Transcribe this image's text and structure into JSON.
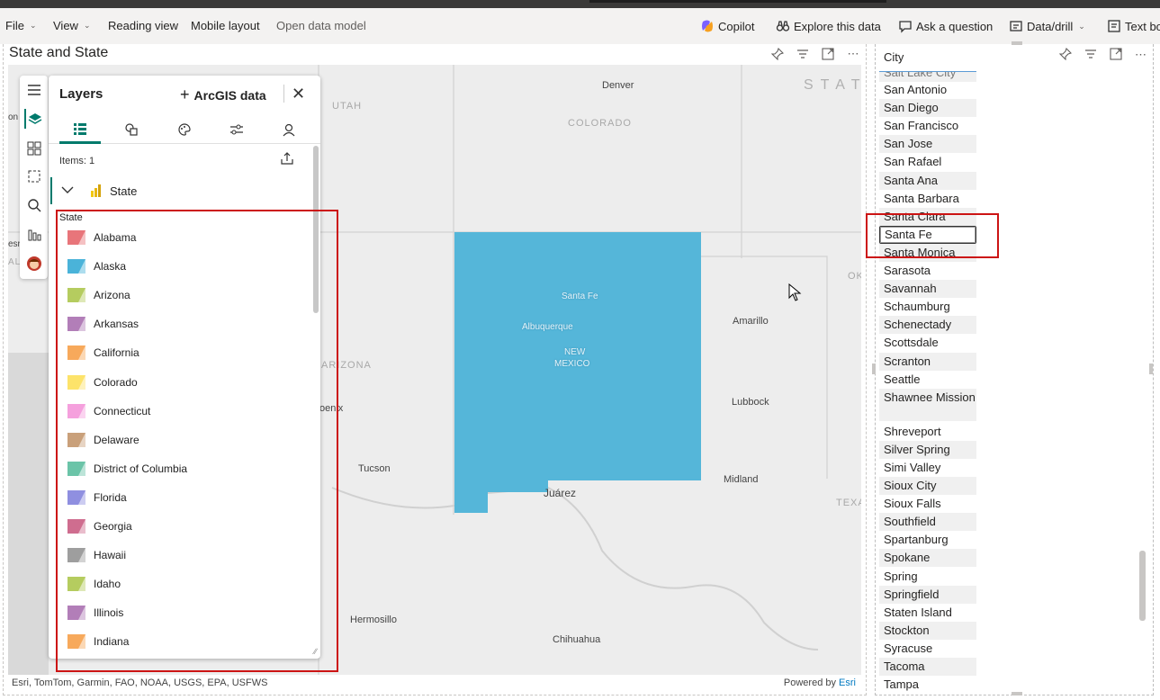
{
  "menubar": {
    "file": "File",
    "view": "View",
    "reading_view": "Reading view",
    "mobile_layout": "Mobile layout",
    "open_data_model": "Open data model",
    "copilot": "Copilot",
    "explore": "Explore this data",
    "ask": "Ask a question",
    "data_drill": "Data/drill",
    "text_box": "Text bo"
  },
  "map_visual": {
    "title": "State and State",
    "attribution_left": "Esri, TomTom, Garmin, FAO, NOAA, USGS, EPA, USFWS",
    "powered_by": "Powered by",
    "esri": "Esri",
    "highlight_color": "#55b6d9",
    "labels": {
      "denver": "Denver",
      "colorado": "COLORADO",
      "utah": "UTAH",
      "states_partial": "STAT",
      "santa_fe": "Santa Fe",
      "albuquerque": "Albuquerque",
      "new": "NEW",
      "mexico": "MEXICO",
      "amarillo": "Amarillo",
      "lubbock": "Lubbock",
      "midland": "Midland",
      "juarez": "Juárez",
      "tucson": "Tucson",
      "phoenix": "oenix",
      "arizona": "ARIZONA",
      "hermosillo": "Hermosillo",
      "chihuahua": "Chihuahua",
      "texas_partial": "TEXA",
      "ok_partial": "OK",
      "left_on": "on",
      "left_esr": "esr",
      "left_al": "AL"
    }
  },
  "layers_panel": {
    "title": "Layers",
    "add_data": "ArcGIS data",
    "items_count": "Items: 1",
    "layer_name": "State",
    "legend_title": "State",
    "legend": [
      {
        "label": "Alabama",
        "color": "#e8757a"
      },
      {
        "label": "Alaska",
        "color": "#4ab3d9"
      },
      {
        "label": "Arizona",
        "color": "#b5cc5f"
      },
      {
        "label": "Arkansas",
        "color": "#b27eb8"
      },
      {
        "label": "California",
        "color": "#f7a95b"
      },
      {
        "label": "Colorado",
        "color": "#fde36a"
      },
      {
        "label": "Connecticut",
        "color": "#f5a0dd"
      },
      {
        "label": "Delaware",
        "color": "#c9a07a"
      },
      {
        "label": "District of Columbia",
        "color": "#6bc4a8"
      },
      {
        "label": "Florida",
        "color": "#8f8fe0"
      },
      {
        "label": "Georgia",
        "color": "#cf6d8f"
      },
      {
        "label": "Hawaii",
        "color": "#9e9e9e"
      },
      {
        "label": "Idaho",
        "color": "#b5cc5f"
      },
      {
        "label": "Illinois",
        "color": "#b27eb8"
      },
      {
        "label": "Indiana",
        "color": "#f7a95b"
      }
    ]
  },
  "slicer": {
    "title": "City",
    "partial_top": "Salt Lake City",
    "cities": [
      "San Antonio",
      "San Diego",
      "San Francisco",
      "San Jose",
      "San Rafael",
      "Santa Ana",
      "Santa Barbara",
      "Santa Clara",
      "Santa Fe",
      "Santa Monica",
      "Sarasota",
      "Savannah",
      "Schaumburg",
      "Schenectady",
      "Scottsdale",
      "Scranton",
      "Seattle",
      "Shawnee Mission",
      "Shreveport",
      "Silver Spring",
      "Simi Valley",
      "Sioux City",
      "Sioux Falls",
      "Southfield",
      "Spartanburg",
      "Spokane",
      "Spring",
      "Springfield",
      "Staten Island",
      "Stockton",
      "Syracuse",
      "Tacoma",
      "Tampa"
    ],
    "selected": "Santa Fe",
    "annotation_color": "#cc1414"
  }
}
